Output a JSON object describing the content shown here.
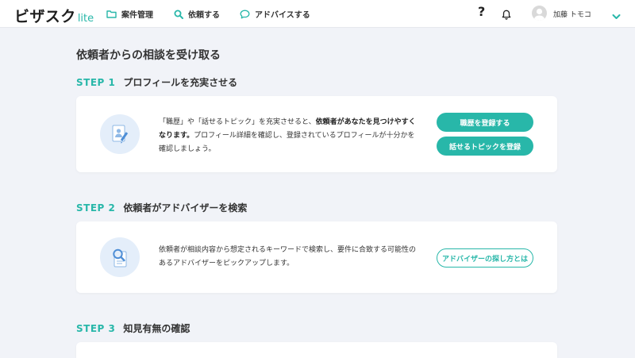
{
  "header": {
    "logo_text": "ビザスク",
    "logo_sub": "lite",
    "nav": [
      {
        "label": "案件管理",
        "icon": "folder-icon"
      },
      {
        "label": "依頼する",
        "icon": "search-icon"
      },
      {
        "label": "アドバイスする",
        "icon": "chat-bubble-icon"
      }
    ],
    "help_label": "?",
    "user_name": "加藤 トモコ"
  },
  "page": {
    "title": "依頼者からの相談を受け取る"
  },
  "steps": [
    {
      "num": "STEP 1",
      "title": "プロフィールを充実させる",
      "text_a": "「職歴」や「話せるトピック」を充実させると、",
      "text_b": "依頼者があなたを見つけやすくなります。",
      "text_c": "プロフィール詳細を確認し、登録されているプロフィールが十分かを確認しましょう。",
      "buttons": [
        "職歴を登録する",
        "話せるトピックを登録"
      ]
    },
    {
      "num": "STEP 2",
      "title": "依頼者がアドバイザーを検索",
      "text": "依頼者が相談内容から想定されるキーワードで検索し、要件に合致する可能性のあるアドバイザーをピックアップします。",
      "buttons": [
        "アドバイザーの探し方とは"
      ]
    },
    {
      "num": "STEP 3",
      "title": "知見有無の確認"
    }
  ],
  "colors": {
    "accent": "#28b7a9",
    "background": "#f1f3f8",
    "icon_circle": "#e4eefa"
  }
}
